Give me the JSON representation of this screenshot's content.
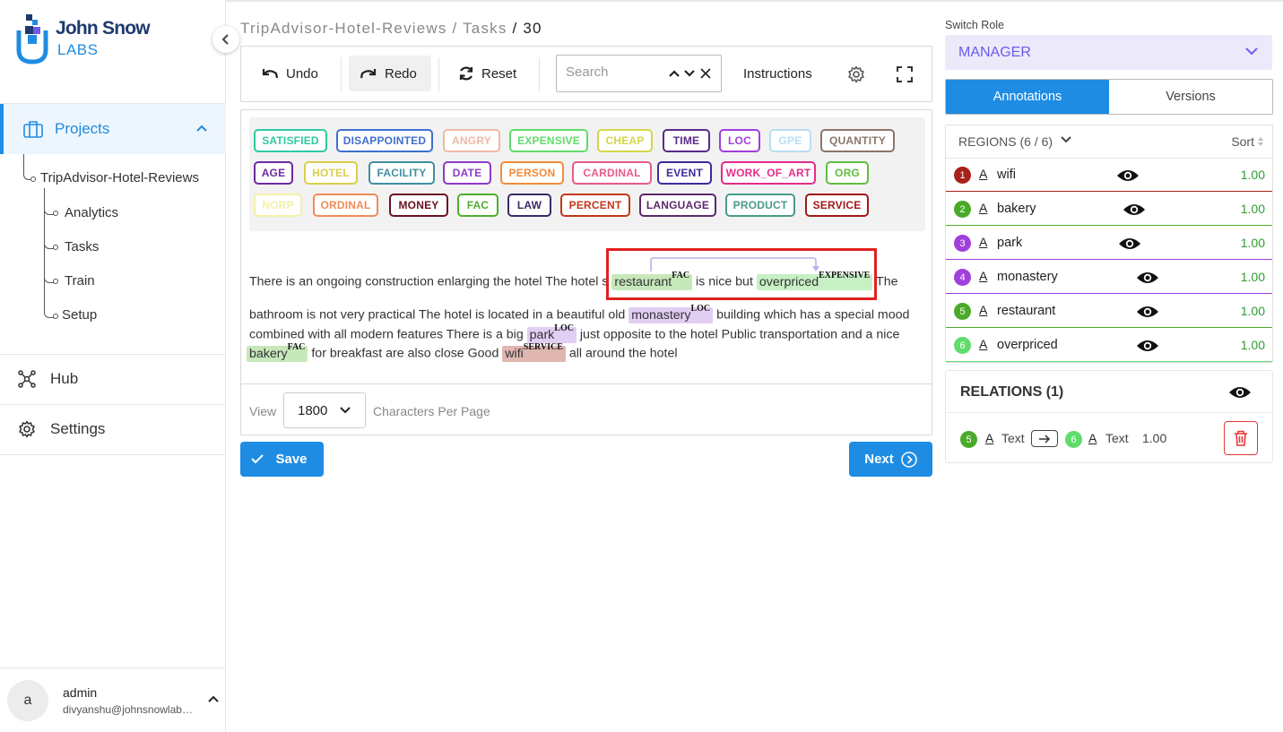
{
  "brand": {
    "name": "John Snow",
    "sub": "LABS"
  },
  "sidebar": {
    "projects_label": "Projects",
    "project_name": "TripAdvisor-Hotel-Reviews",
    "sub_items": [
      "Analytics",
      "Tasks",
      "Train",
      "Setup"
    ],
    "hub_label": "Hub",
    "settings_label": "Settings",
    "user": {
      "initial": "a",
      "name": "admin",
      "email": "divyanshu@johnsnowlabs.com"
    }
  },
  "breadcrumb": {
    "project": "TripAdvisor-Hotel-Reviews",
    "section": "Tasks",
    "task": "30",
    "sep": "/"
  },
  "toolbar": {
    "undo": "Undo",
    "redo": "Redo",
    "reset": "Reset",
    "search_placeholder": "Search",
    "instructions": "Instructions"
  },
  "labels": [
    {
      "text": "SATISFIED",
      "color": "#2ec9a0"
    },
    {
      "text": "DISAPPOINTED",
      "color": "#3f6fcf"
    },
    {
      "text": "ANGRY",
      "color": "#f0b8a6"
    },
    {
      "text": "EXPENSIVE",
      "color": "#5fdc6a"
    },
    {
      "text": "CHEAP",
      "color": "#d4d64a"
    },
    {
      "text": "TIME",
      "color": "#5a2a8a"
    },
    {
      "text": "LOC",
      "color": "#a13fdc"
    },
    {
      "text": "GPE",
      "color": "#b8def3"
    },
    {
      "text": "QUANTITY",
      "color": "#8d7468"
    },
    {
      "text": "AGE",
      "color": "#6a2aa0"
    },
    {
      "text": "HOTEL",
      "color": "#d9cf4b"
    },
    {
      "text": "FACILITY",
      "color": "#3f8f9f"
    },
    {
      "text": "DATE",
      "color": "#8e3acb"
    },
    {
      "text": "PERSON",
      "color": "#f08c3a"
    },
    {
      "text": "CARDINAL",
      "color": "#e85a8a"
    },
    {
      "text": "EVENT",
      "color": "#3f2a9f"
    },
    {
      "text": "WORK_OF_ART",
      "color": "#e62c8a"
    },
    {
      "text": "ORG",
      "color": "#5fbe3e"
    },
    {
      "text": "NORP",
      "color": "#f3f0a8"
    },
    {
      "text": "ORDINAL",
      "color": "#f08c5a"
    },
    {
      "text": "MONEY",
      "color": "#6a1020"
    },
    {
      "text": "FAC",
      "color": "#4fae2e"
    },
    {
      "text": "LAW",
      "color": "#3a2a6a"
    },
    {
      "text": "PERCENT",
      "color": "#c0381a"
    },
    {
      "text": "LANGUAGE",
      "color": "#5a2a6a"
    },
    {
      "text": "PRODUCT",
      "color": "#4a9a8a"
    },
    {
      "text": "SERVICE",
      "color": "#a01818"
    }
  ],
  "text": {
    "l1_a": "There is an ongoing construction enlarging the hotel The hotel s",
    "e_restaurant": "restaurant",
    "e_restaurant_tag": "FAC",
    "l1_b": "is nice but",
    "e_overpriced": "overpriced",
    "e_overpriced_tag": "EXPENSIVE",
    "l1_c": "The",
    "l2_a": "bathroom is not very practical The hotel is located in a beautiful old",
    "e_monastery": "monastery",
    "e_monastery_tag": "LOC",
    "l2_b": "building which has a special mood",
    "l3_a": "combined with all modern features There is a big",
    "e_park": "park",
    "e_park_tag": "LOC",
    "l3_b": "just opposite to the hotel Public transportation and a nice",
    "e_bakery": "bakery",
    "e_bakery_tag": "FAC",
    "l4_a": "for breakfast are also close Good",
    "e_wifi": "wifi",
    "e_wifi_tag": "SERVICE",
    "l4_b": "all around the hotel"
  },
  "view": {
    "label": "View",
    "value": "1800",
    "suffix": "Characters Per Page"
  },
  "actions": {
    "save": "Save",
    "next": "Next"
  },
  "right": {
    "switch_role_label": "Switch Role",
    "role": "MANAGER",
    "tabs": [
      "Annotations",
      "Versions"
    ],
    "regions_title": "REGIONS (6 / 6)",
    "sort_label": "Sort",
    "regions": [
      {
        "n": "1",
        "name": "wifi",
        "score": "1.00",
        "color": "#a8221a"
      },
      {
        "n": "2",
        "name": "bakery",
        "score": "1.00",
        "color": "#4aaa2a"
      },
      {
        "n": "3",
        "name": "park",
        "score": "1.00",
        "color": "#a13fdc"
      },
      {
        "n": "4",
        "name": "monastery",
        "score": "1.00",
        "color": "#a13fdc"
      },
      {
        "n": "5",
        "name": "restaurant",
        "score": "1.00",
        "color": "#4aaa2a"
      },
      {
        "n": "6",
        "name": "overpriced",
        "score": "1.00",
        "color": "#5fdc6a"
      }
    ],
    "relations_title": "RELATIONS (1)",
    "relation": {
      "from_n": "5",
      "from_text": "Text",
      "to_n": "6",
      "to_text": "Text",
      "score": "1.00"
    }
  }
}
